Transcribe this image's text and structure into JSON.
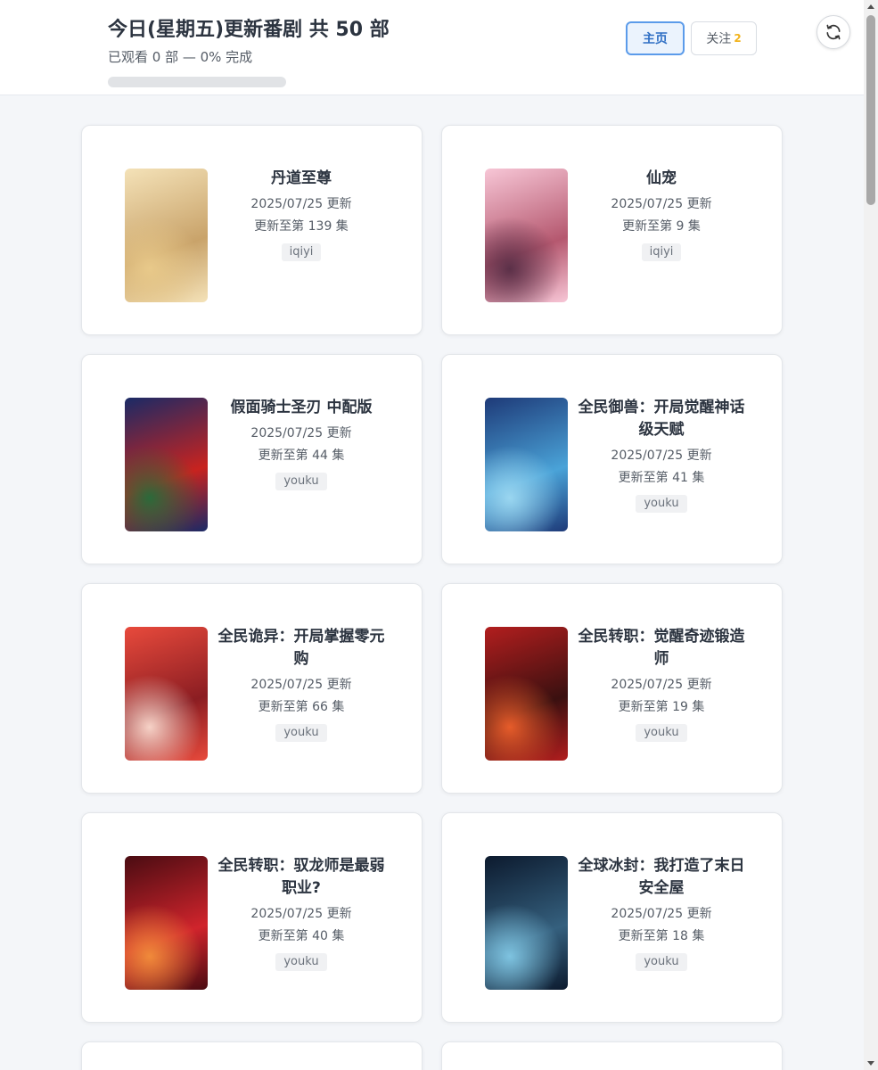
{
  "header": {
    "title": "今日(星期五)更新番剧 共 50 部",
    "subtitle": "已观看 0 部 — 0% 完成",
    "progress_fraction": 0
  },
  "nav": {
    "home_label": "主页",
    "follow_label": "关注",
    "follow_count": "2",
    "refresh_icon": "refresh-icon"
  },
  "cards": [
    {
      "title": "丹道至尊",
      "date": "2025/07/25 更新",
      "episode": "更新至第 139 集",
      "platform": "iqiyi",
      "colors": [
        "#f4e2b8",
        "#c9a36a",
        "#e8c98a"
      ]
    },
    {
      "title": "仙宠",
      "date": "2025/07/25 更新",
      "episode": "更新至第 9 集",
      "platform": "iqiyi",
      "colors": [
        "#f7c6d6",
        "#b5586f",
        "#5b3048"
      ]
    },
    {
      "title": "假面骑士圣刃 中配版",
      "date": "2025/07/25 更新",
      "episode": "更新至第 44 集",
      "platform": "youku",
      "colors": [
        "#1a2a66",
        "#c8231f",
        "#2b6a3a"
      ]
    },
    {
      "title": "全民御兽：开局觉醒神话级天赋",
      "date": "2025/07/25 更新",
      "episode": "更新至第 41 集",
      "platform": "youku",
      "colors": [
        "#1e3a78",
        "#4aa3d8",
        "#9ad6f0"
      ]
    },
    {
      "title": "全民诡异：开局掌握零元购",
      "date": "2025/07/25 更新",
      "episode": "更新至第 66 集",
      "platform": "youku",
      "colors": [
        "#e84a3c",
        "#8b1d22",
        "#f6d2c7"
      ]
    },
    {
      "title": "全民转职：觉醒奇迹锻造师",
      "date": "2025/07/25 更新",
      "episode": "更新至第 19 集",
      "platform": "youku",
      "colors": [
        "#b21e1e",
        "#3a1010",
        "#e65c2a"
      ]
    },
    {
      "title": "全民转职：驭龙师是最弱职业?",
      "date": "2025/07/25 更新",
      "episode": "更新至第 40 集",
      "platform": "youku",
      "colors": [
        "#4a0c12",
        "#d0242c",
        "#f08a3a"
      ]
    },
    {
      "title": "全球冰封：我打造了末日安全屋",
      "date": "2025/07/25 更新",
      "episode": "更新至第 18 集",
      "platform": "youku",
      "colors": [
        "#0c1a2e",
        "#35607e",
        "#7ec3e0"
      ]
    }
  ]
}
